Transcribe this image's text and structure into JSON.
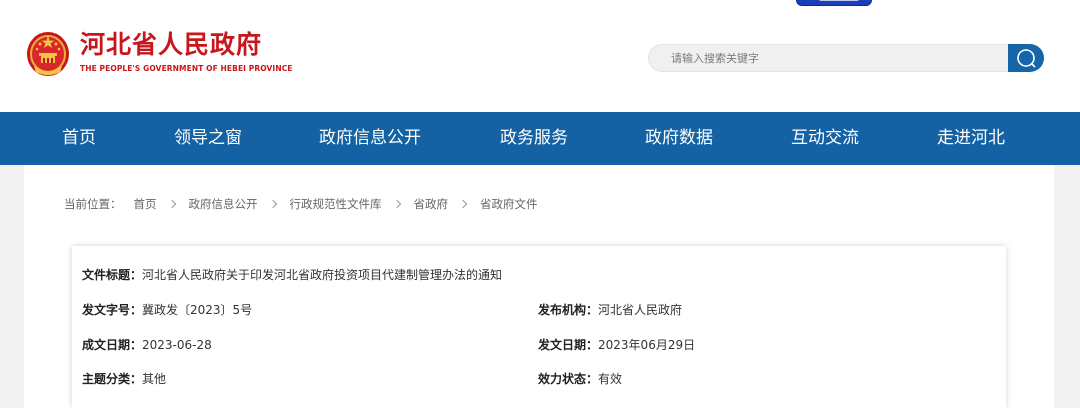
{
  "header": {
    "site_title": "河北省人民政府",
    "site_subtitle": "THE PEOPLE'S GOVERNMENT OF HEBEI PROVINCE",
    "search_placeholder": "请输入搜索关键字"
  },
  "nav": {
    "items": [
      "首页",
      "领导之窗",
      "政府信息公开",
      "政务服务",
      "政府数据",
      "互动交流",
      "走进河北"
    ]
  },
  "breadcrumb": {
    "label": "当前位置：",
    "items": [
      "首页",
      "政府信息公开",
      "行政规范性文件库",
      "省政府",
      "省政府文件"
    ]
  },
  "doc_info": {
    "title_key": "文件标题：",
    "title_value": "河北省人民政府关于印发河北省政府投资项目代建制管理办法的通知",
    "doc_no_key": "发文字号：",
    "doc_no_value": "冀政发〔2023〕5号",
    "issuer_key": "发布机构：",
    "issuer_value": "河北省人民政府",
    "created_key": "成文日期：",
    "created_value": "2023-06-28",
    "published_key": "发文日期：",
    "published_value": "2023年06月29日",
    "category_key": "主题分类：",
    "category_value": "其他",
    "status_key": "效力状态：",
    "status_value": "有效"
  },
  "colors": {
    "brand_red": "#c8161d",
    "nav_blue": "#1462a3",
    "search_blue": "#1665a8"
  }
}
